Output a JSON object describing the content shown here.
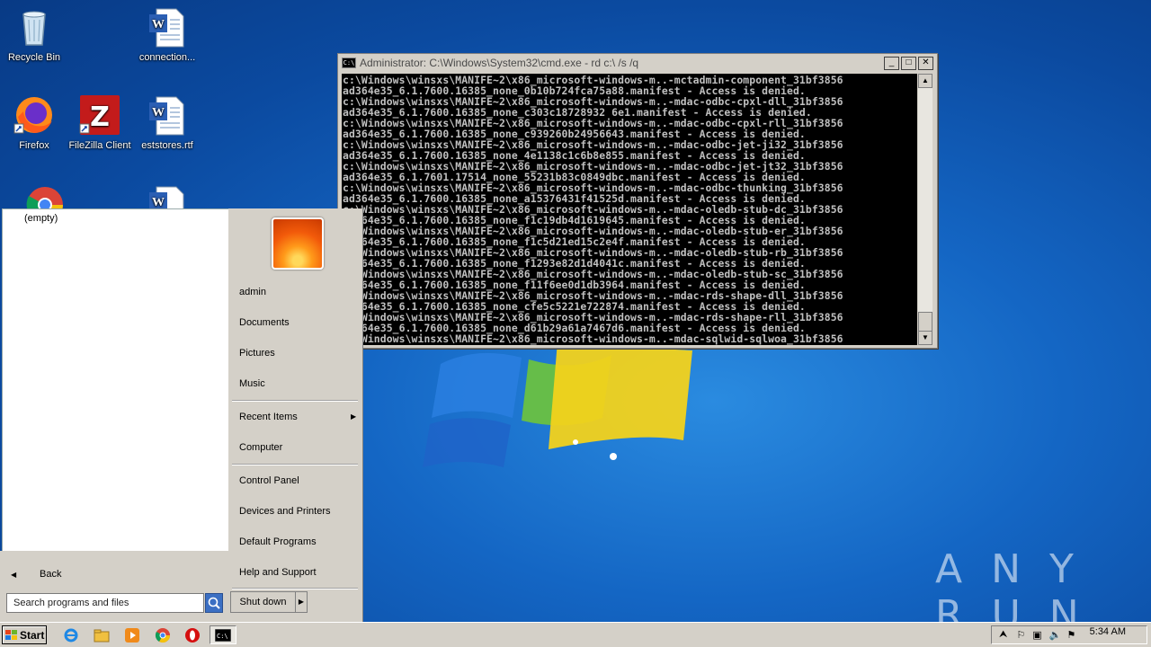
{
  "desktop": {
    "icons": [
      {
        "label": "Recycle Bin",
        "icon": "recycle-bin-icon"
      },
      {
        "label": "connection...",
        "icon": "word-document-icon"
      },
      {
        "label": "Firefox",
        "icon": "firefox-icon"
      },
      {
        "label": "FileZilla Client",
        "icon": "filezilla-icon"
      },
      {
        "label": "eststores.rtf",
        "icon": "word-document-icon"
      }
    ],
    "watermark": "ANY RUN"
  },
  "cmd_window": {
    "title": "Administrator: C:\\Windows\\System32\\cmd.exe - rd  c:\\ /s /q",
    "buttons": {
      "minimize": "_",
      "maximize": "□",
      "close": "✕"
    },
    "lines": [
      "c:\\Windows\\winsxs\\MANIFE~2\\x86_microsoft-windows-m..-mctadmin-component_31bf3856",
      "ad364e35_6.1.7600.16385_none_0b10b724fca75a88.manifest - Access is denied.",
      "c:\\Windows\\winsxs\\MANIFE~2\\x86_microsoft-windows-m..-mdac-odbc-cpxl-dll_31bf3856",
      "ad364e35_6.1.7600.16385_none_c303c18728932 6e1.manifest - Access is denied.",
      "c:\\Windows\\winsxs\\MANIFE~2\\x86_microsoft-windows-m..-mdac-odbc-cpxl-rll_31bf3856",
      "ad364e35_6.1.7600.16385_none_c939260b24956643.manifest - Access is denied.",
      "c:\\Windows\\winsxs\\MANIFE~2\\x86_microsoft-windows-m..-mdac-odbc-jet-ji32_31bf3856",
      "ad364e35_6.1.7600.16385_none_4e1138c1c6b8e855.manifest - Access is denied.",
      "c:\\Windows\\winsxs\\MANIFE~2\\x86_microsoft-windows-m..-mdac-odbc-jet-jt32_31bf3856",
      "ad364e35_6.1.7601.17514_none_55231b83c0849dbc.manifest - Access is denied.",
      "c:\\Windows\\winsxs\\MANIFE~2\\x86_microsoft-windows-m..-mdac-odbc-thunking_31bf3856",
      "ad364e35_6.1.7600.16385_none_a15376431f41525d.manifest - Access is denied.",
      "c:\\Windows\\winsxs\\MANIFE~2\\x86_microsoft-windows-m..-mdac-oledb-stub-dc_31bf3856",
      "ad364e35_6.1.7600.16385_none_f1c19db4d1619645.manifest - Access is denied.",
      "c:\\Windows\\winsxs\\MANIFE~2\\x86_microsoft-windows-m..-mdac-oledb-stub-er_31bf3856",
      "ad364e35_6.1.7600.16385_none_f1c5d21ed15c2e4f.manifest - Access is denied.",
      "c:\\Windows\\winsxs\\MANIFE~2\\x86_microsoft-windows-m..-mdac-oledb-stub-rb_31bf3856",
      "ad364e35_6.1.7600.16385_none_f1293e82d1d4041c.manifest - Access is denied.",
      "c:\\Windows\\winsxs\\MANIFE~2\\x86_microsoft-windows-m..-mdac-oledb-stub-sc_31bf3856",
      "ad364e35_6.1.7600.16385_none_f11f6ee0d1db3964.manifest - Access is denied.",
      "c:\\Windows\\winsxs\\MANIFE~2\\x86_microsoft-windows-m..-mdac-rds-shape-dll_31bf3856",
      "ad364e35_6.1.7600.16385_none_cfe5c5221e722874.manifest - Access is denied.",
      "c:\\Windows\\winsxs\\MANIFE~2\\x86_microsoft-windows-m..-mdac-rds-shape-rll_31bf3856",
      "ad364e35_6.1.7600.16385_none_d61b29a61a7467d6.manifest - Access is denied.",
      "c:\\Windows\\winsxs\\MANIFE~2\\x86_microsoft-windows-m..-mdac-sqlwid-sqlwoa_31bf3856"
    ]
  },
  "start_menu": {
    "recent_programs_empty": "(empty)",
    "back_label": "Back",
    "search_placeholder": "Search programs and files",
    "shutdown_label": "Shut down",
    "right_items": {
      "admin": "admin",
      "documents": "Documents",
      "pictures": "Pictures",
      "music": "Music",
      "recent_items": "Recent Items",
      "computer": "Computer",
      "control_panel": "Control Panel",
      "devices_printers": "Devices and Printers",
      "default_programs": "Default Programs",
      "help_support": "Help and Support"
    }
  },
  "taskbar": {
    "start_label": "Start",
    "pinned": [
      "internet-explorer-icon",
      "explorer-folder-icon",
      "media-player-icon",
      "chrome-icon",
      "opera-icon",
      "cmd-icon"
    ],
    "clock": "5:34 AM"
  }
}
